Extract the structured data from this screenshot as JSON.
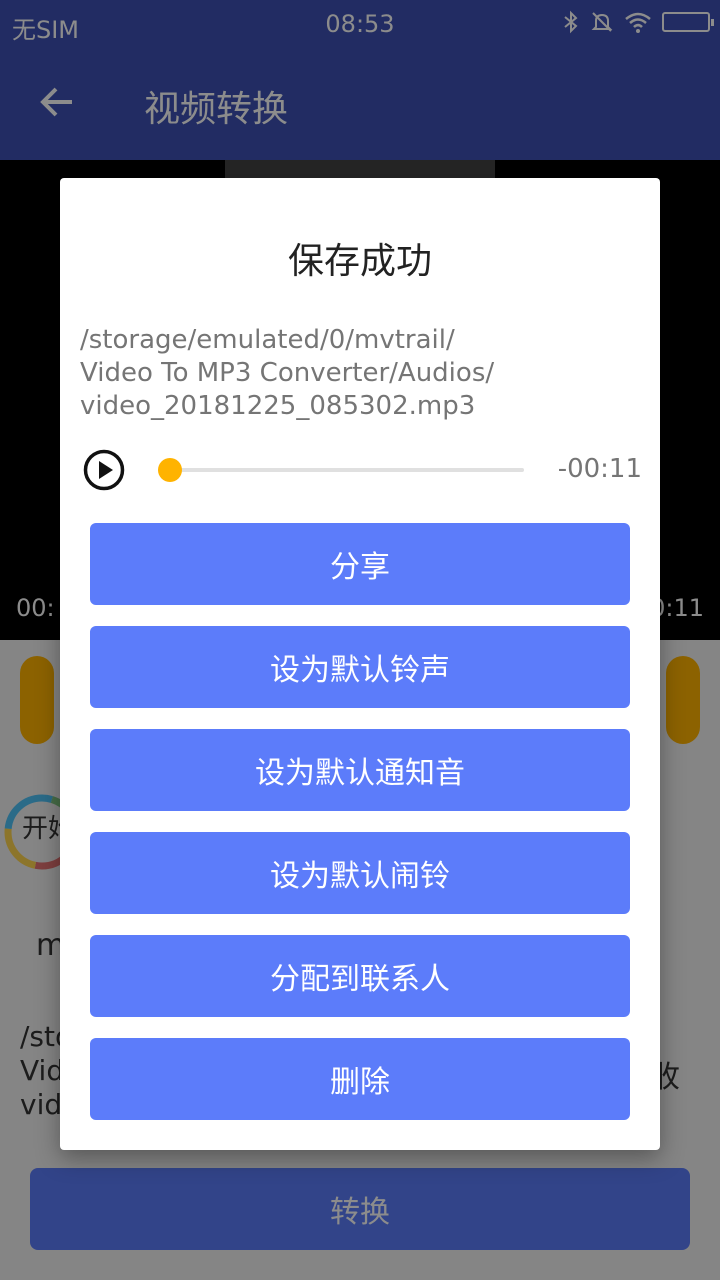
{
  "status_bar": {
    "carrier": "无SIM",
    "time": "08:53",
    "icons": [
      "bluetooth-icon",
      "mute-icon",
      "wifi-icon",
      "battery-icon"
    ]
  },
  "app_bar": {
    "title": "视频转换",
    "back_icon": "arrow-left-icon"
  },
  "background": {
    "video_time_left": "00:",
    "video_time_right": "0:11",
    "start_label": "开始",
    "format_partial": "m",
    "path_lines": [
      "/sto",
      "Vid",
      "vide"
    ],
    "save_partial": "收",
    "convert_label": "转换"
  },
  "dialog": {
    "title": "保存成功",
    "path_lines": [
      "/storage/emulated/0/mvtrail/",
      "Video To MP3 Converter/Audios/",
      "video_20181225_085302.mp3"
    ],
    "player": {
      "play_icon": "play-circle-icon",
      "progress": 0,
      "remaining_time": "-00:11"
    },
    "buttons": [
      {
        "label": "分享"
      },
      {
        "label": "设为默认铃声"
      },
      {
        "label": "设为默认通知音"
      },
      {
        "label": "设为默认闹铃"
      },
      {
        "label": "分配到联系人"
      },
      {
        "label": "删除"
      }
    ]
  },
  "colors": {
    "app_bar": "#3f51b5",
    "button": "#5c7cfa",
    "accent": "#ffb300"
  }
}
